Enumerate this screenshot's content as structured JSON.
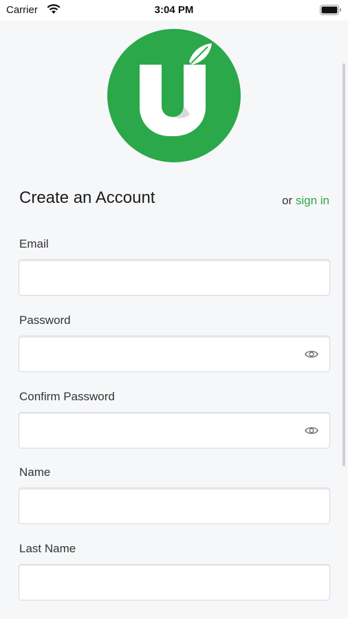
{
  "status_bar": {
    "carrier": "Carrier",
    "time": "3:04 PM"
  },
  "logo": {
    "brand_color": "#2aa84a",
    "icon": "leaf-u-logo"
  },
  "header": {
    "title": "Create an Account",
    "or_text": "or",
    "signin_link": "sign in",
    "link_color": "#2aa84a"
  },
  "form": {
    "fields": [
      {
        "label": "Email",
        "value": "",
        "has_eye_icon": false
      },
      {
        "label": "Password",
        "value": "",
        "has_eye_icon": true
      },
      {
        "label": "Confirm Password",
        "value": "",
        "has_eye_icon": true
      },
      {
        "label": "Name",
        "value": "",
        "has_eye_icon": false
      },
      {
        "label": "Last Name",
        "value": "",
        "has_eye_icon": false
      }
    ]
  }
}
